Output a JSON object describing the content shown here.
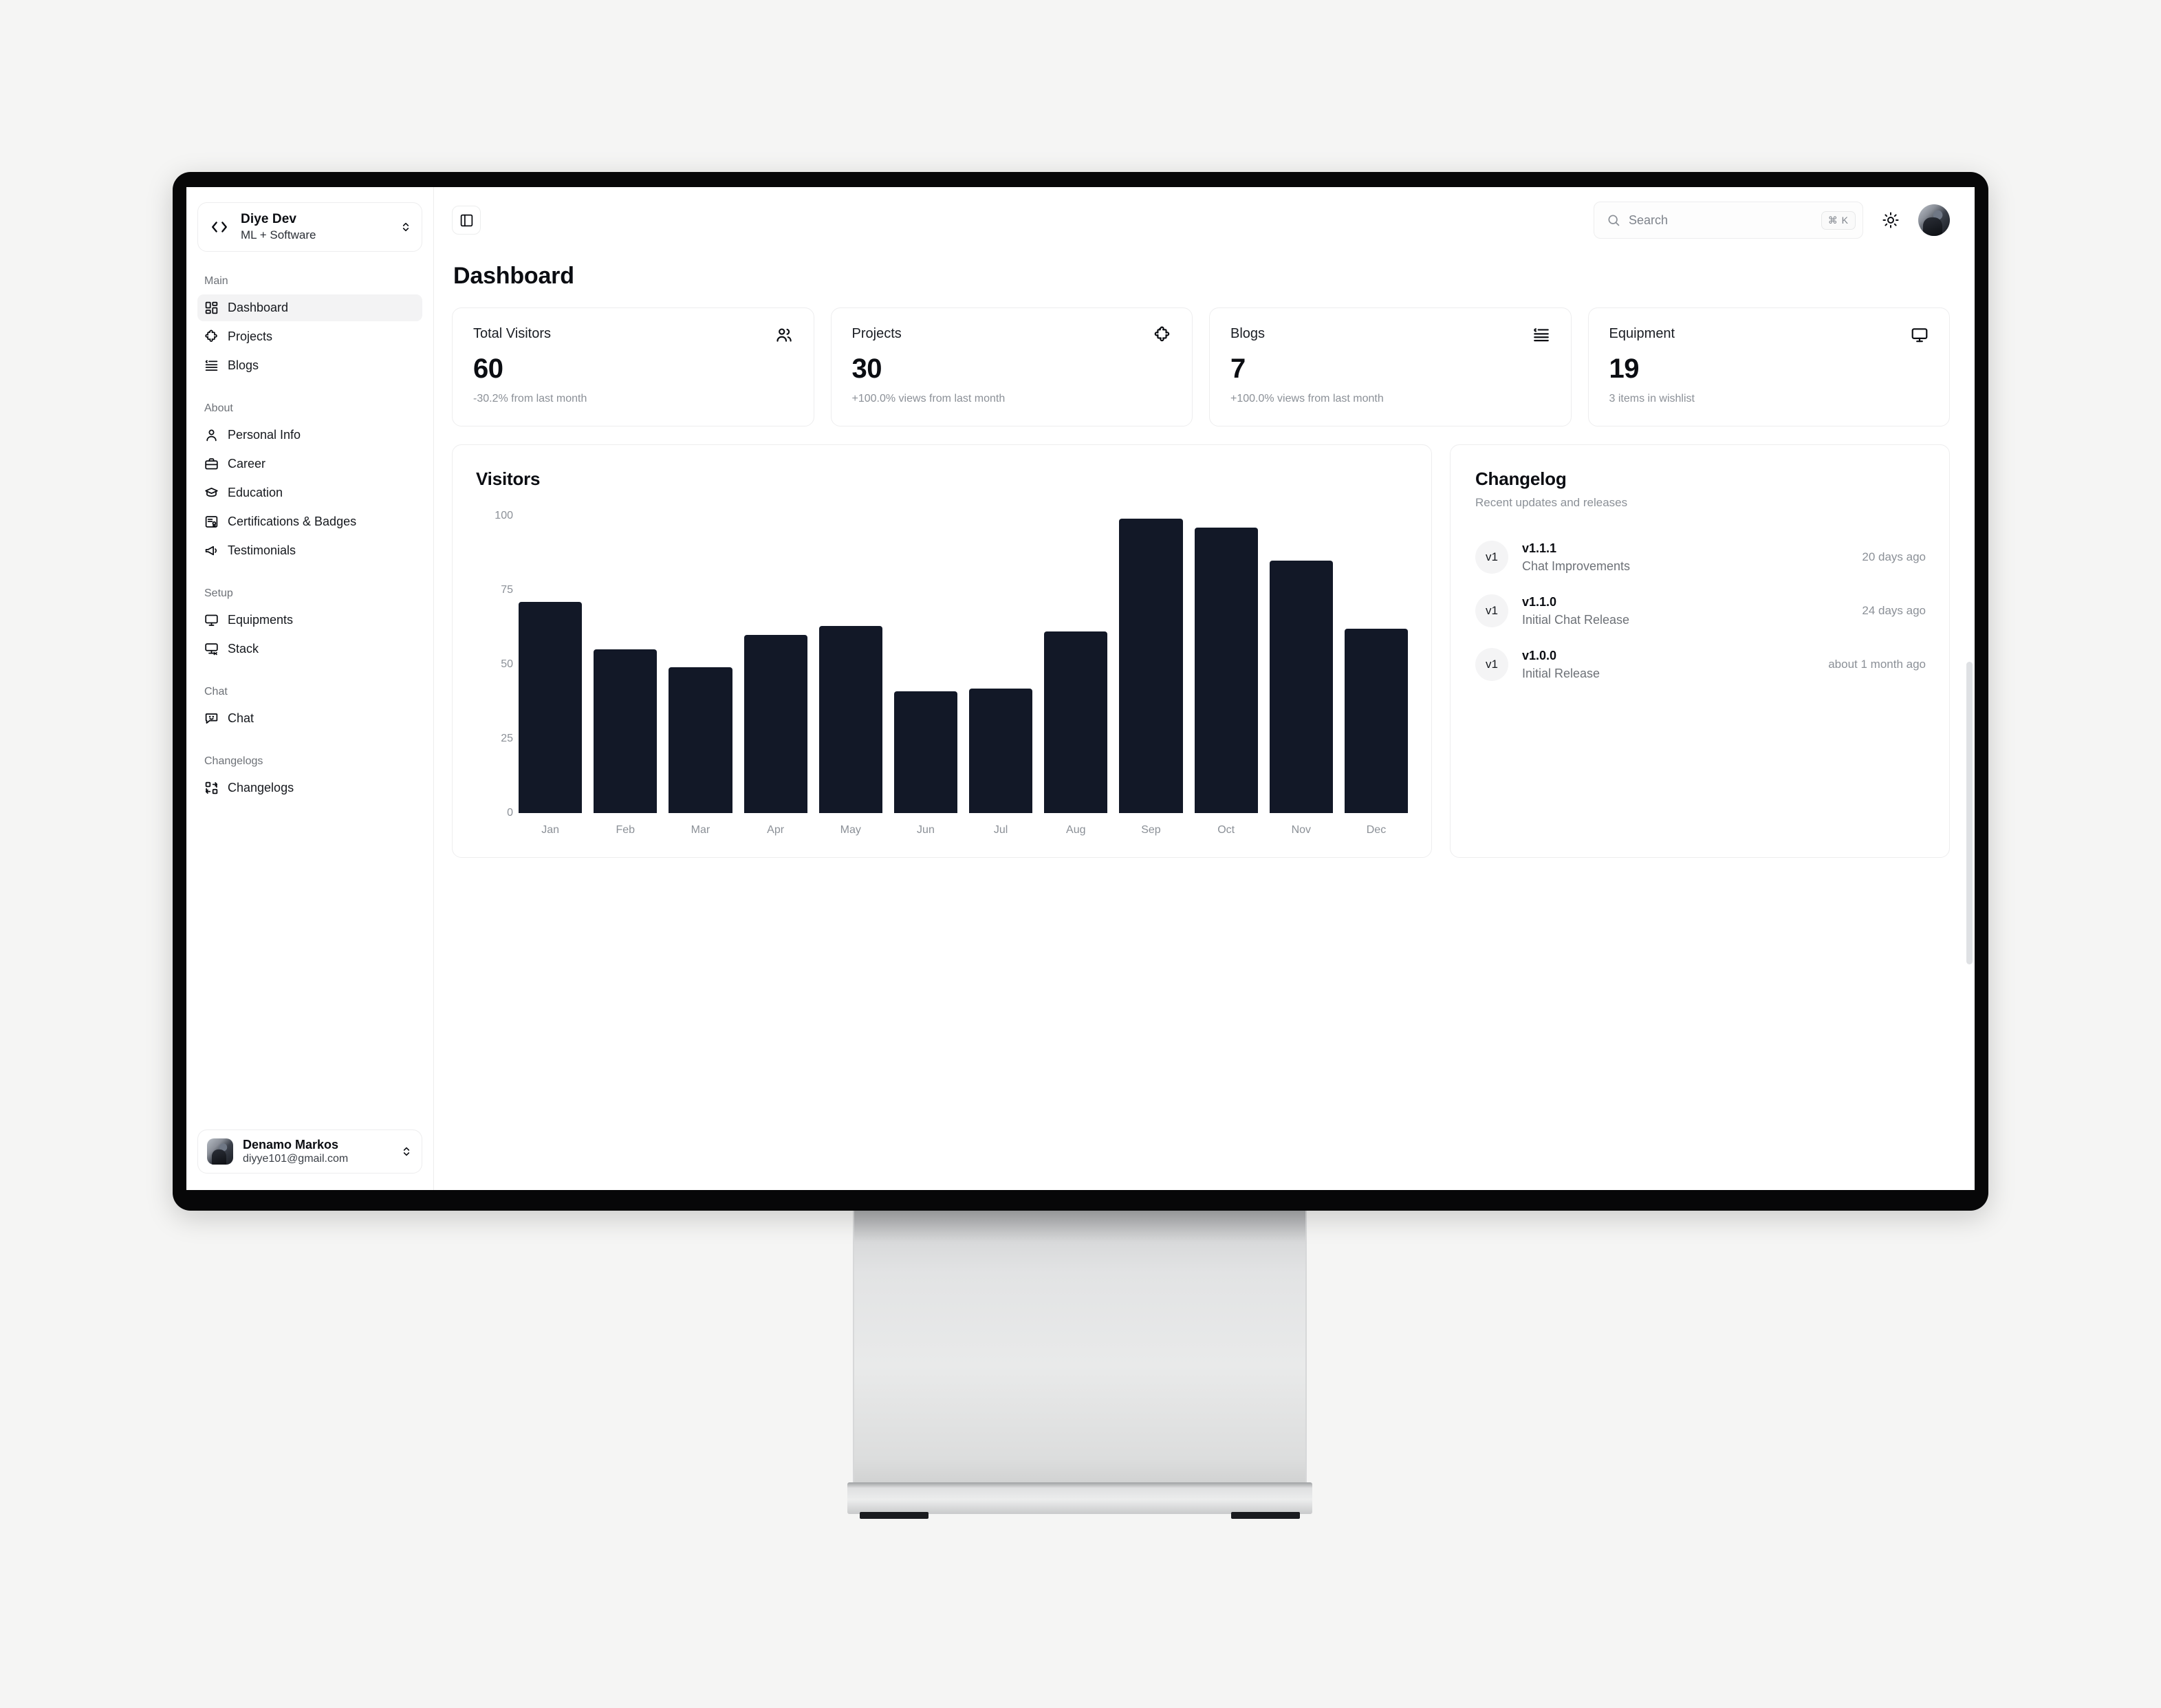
{
  "brand": {
    "name": "Diye Dev",
    "tagline": "ML + Software",
    "logo_icon": "code-brackets-icon"
  },
  "sidebar": {
    "sections": [
      {
        "label": "Main",
        "items": [
          {
            "label": "Dashboard",
            "icon": "layout-dashboard-icon",
            "active": true
          },
          {
            "label": "Projects",
            "icon": "puzzle-icon",
            "active": false
          },
          {
            "label": "Blogs",
            "icon": "quote-list-icon",
            "active": false
          }
        ]
      },
      {
        "label": "About",
        "items": [
          {
            "label": "Personal Info",
            "icon": "user-icon",
            "active": false
          },
          {
            "label": "Career",
            "icon": "briefcase-icon",
            "active": false
          },
          {
            "label": "Education",
            "icon": "graduation-cap-icon",
            "active": false
          },
          {
            "label": "Certifications & Badges",
            "icon": "certificate-icon",
            "active": false
          },
          {
            "label": "Testimonials",
            "icon": "megaphone-icon",
            "active": false
          }
        ]
      },
      {
        "label": "Setup",
        "items": [
          {
            "label": "Equipments",
            "icon": "monitor-icon",
            "active": false
          },
          {
            "label": "Stack",
            "icon": "monitor-code-icon",
            "active": false
          }
        ]
      },
      {
        "label": "Chat",
        "items": [
          {
            "label": "Chat",
            "icon": "message-smile-icon",
            "active": false
          }
        ]
      },
      {
        "label": "Changelogs",
        "items": [
          {
            "label": "Changelogs",
            "icon": "git-compare-icon",
            "active": false
          }
        ]
      }
    ],
    "user": {
      "name": "Denamo Markos",
      "email": "diyye101@gmail.com"
    }
  },
  "topbar": {
    "toggle_icon": "panel-left-icon",
    "search": {
      "placeholder": "Search",
      "value": "",
      "shortcut": "⌘ K",
      "icon": "search-icon"
    },
    "theme_toggle_icon": "sun-icon",
    "avatar": "user-avatar"
  },
  "page": {
    "title": "Dashboard"
  },
  "stats": [
    {
      "label": "Total Visitors",
      "value": "60",
      "sub": "-30.2% from last month",
      "icon": "users-icon"
    },
    {
      "label": "Projects",
      "value": "30",
      "sub": "+100.0% views from last month",
      "icon": "puzzle-icon"
    },
    {
      "label": "Blogs",
      "value": "7",
      "sub": "+100.0% views from last month",
      "icon": "quote-list-icon"
    },
    {
      "label": "Equipment",
      "value": "19",
      "sub": "3 items in wishlist",
      "icon": "monitor-icon"
    }
  ],
  "chart_data": {
    "type": "bar",
    "title": "Visitors",
    "xlabel": "",
    "ylabel": "",
    "ylim": [
      0,
      100
    ],
    "yticks": [
      0,
      25,
      50,
      75,
      100
    ],
    "grid": false,
    "legend": "none",
    "bar_color": "#121827",
    "categories": [
      "Jan",
      "Feb",
      "Mar",
      "Apr",
      "May",
      "Jun",
      "Jul",
      "Aug",
      "Sep",
      "Oct",
      "Nov",
      "Dec"
    ],
    "values": [
      71,
      55,
      49,
      60,
      63,
      41,
      42,
      61,
      99,
      96,
      85,
      62
    ]
  },
  "changelog": {
    "title": "Changelog",
    "subtitle": "Recent updates and releases",
    "items": [
      {
        "badge": "v1",
        "version": "v1.1.1",
        "description": "Chat Improvements",
        "time": "20 days ago"
      },
      {
        "badge": "v1",
        "version": "v1.1.0",
        "description": "Initial Chat Release",
        "time": "24 days ago"
      },
      {
        "badge": "v1",
        "version": "v1.0.0",
        "description": "Initial Release",
        "time": "about 1 month ago"
      }
    ]
  }
}
